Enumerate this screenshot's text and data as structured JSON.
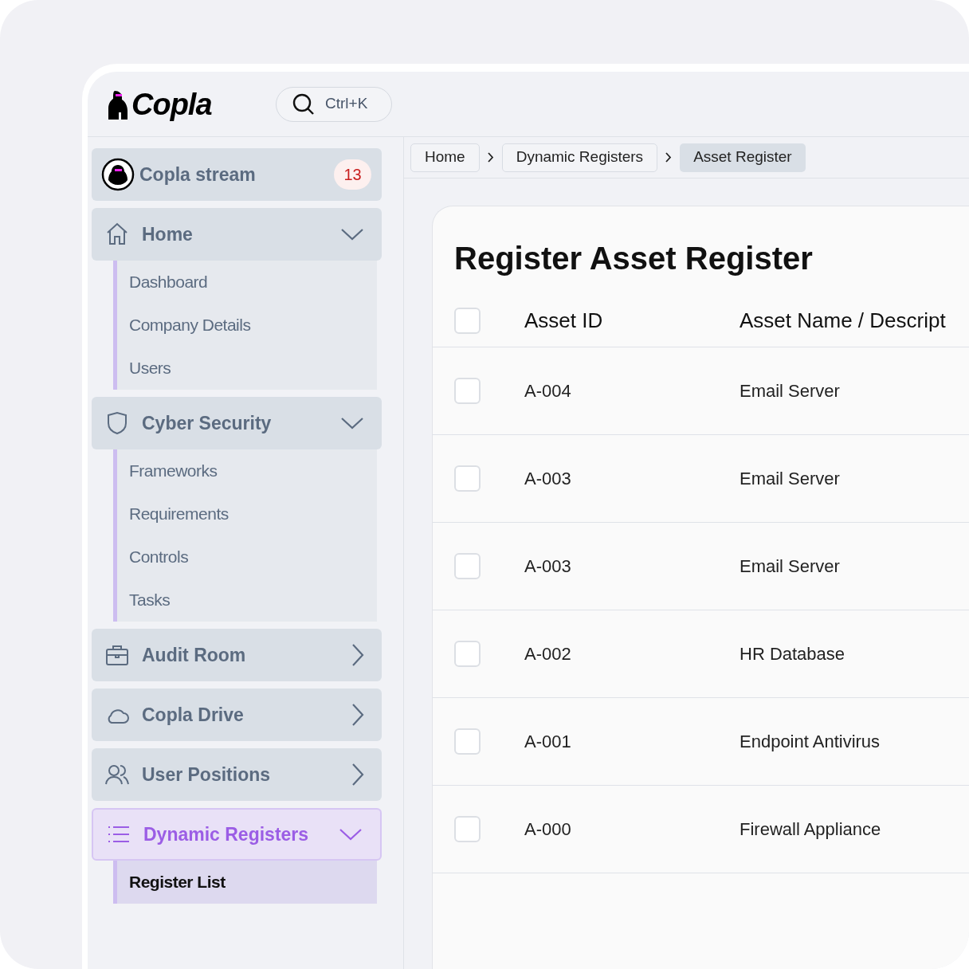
{
  "logo": {
    "text": "Copla"
  },
  "search": {
    "shortcut": "Ctrl+K"
  },
  "sidebar": {
    "stream": {
      "label": "Copla stream",
      "badge": "13"
    },
    "items": [
      {
        "label": "Home",
        "expanded": true,
        "selected": false,
        "children": [
          {
            "label": "Dashboard",
            "selected": false
          },
          {
            "label": "Company Details",
            "selected": false
          },
          {
            "label": "Users",
            "selected": false
          }
        ]
      },
      {
        "label": "Cyber Security",
        "expanded": true,
        "selected": false,
        "children": [
          {
            "label": "Frameworks",
            "selected": false
          },
          {
            "label": "Requirements",
            "selected": false
          },
          {
            "label": "Controls",
            "selected": false
          },
          {
            "label": "Tasks",
            "selected": false
          }
        ]
      },
      {
        "label": "Audit Room",
        "expanded": false,
        "selected": false
      },
      {
        "label": "Copla Drive",
        "expanded": false,
        "selected": false
      },
      {
        "label": "User Positions",
        "expanded": false,
        "selected": false
      },
      {
        "label": "Dynamic Registers",
        "expanded": true,
        "selected": true,
        "children": [
          {
            "label": "Register List",
            "selected": true
          }
        ]
      }
    ]
  },
  "breadcrumbs": [
    {
      "label": "Home",
      "selected": false
    },
    {
      "label": "Dynamic Registers",
      "selected": false
    },
    {
      "label": "Asset Register",
      "selected": true
    }
  ],
  "page": {
    "title": "Register Asset Register"
  },
  "table": {
    "select_all_checked": false,
    "columns": [
      "Asset ID",
      "Asset Name / Descript"
    ],
    "rows": [
      {
        "checked": false,
        "cells": [
          "A-004",
          "Email Server"
        ]
      },
      {
        "checked": false,
        "cells": [
          "A-003",
          "Email Server"
        ]
      },
      {
        "checked": false,
        "cells": [
          "A-003",
          "Email Server"
        ]
      },
      {
        "checked": false,
        "cells": [
          "A-002",
          "HR Database"
        ]
      },
      {
        "checked": false,
        "cells": [
          "A-001",
          "Endpoint Antivirus"
        ]
      },
      {
        "checked": false,
        "cells": [
          "A-000",
          "Firewall Appliance"
        ]
      }
    ]
  }
}
